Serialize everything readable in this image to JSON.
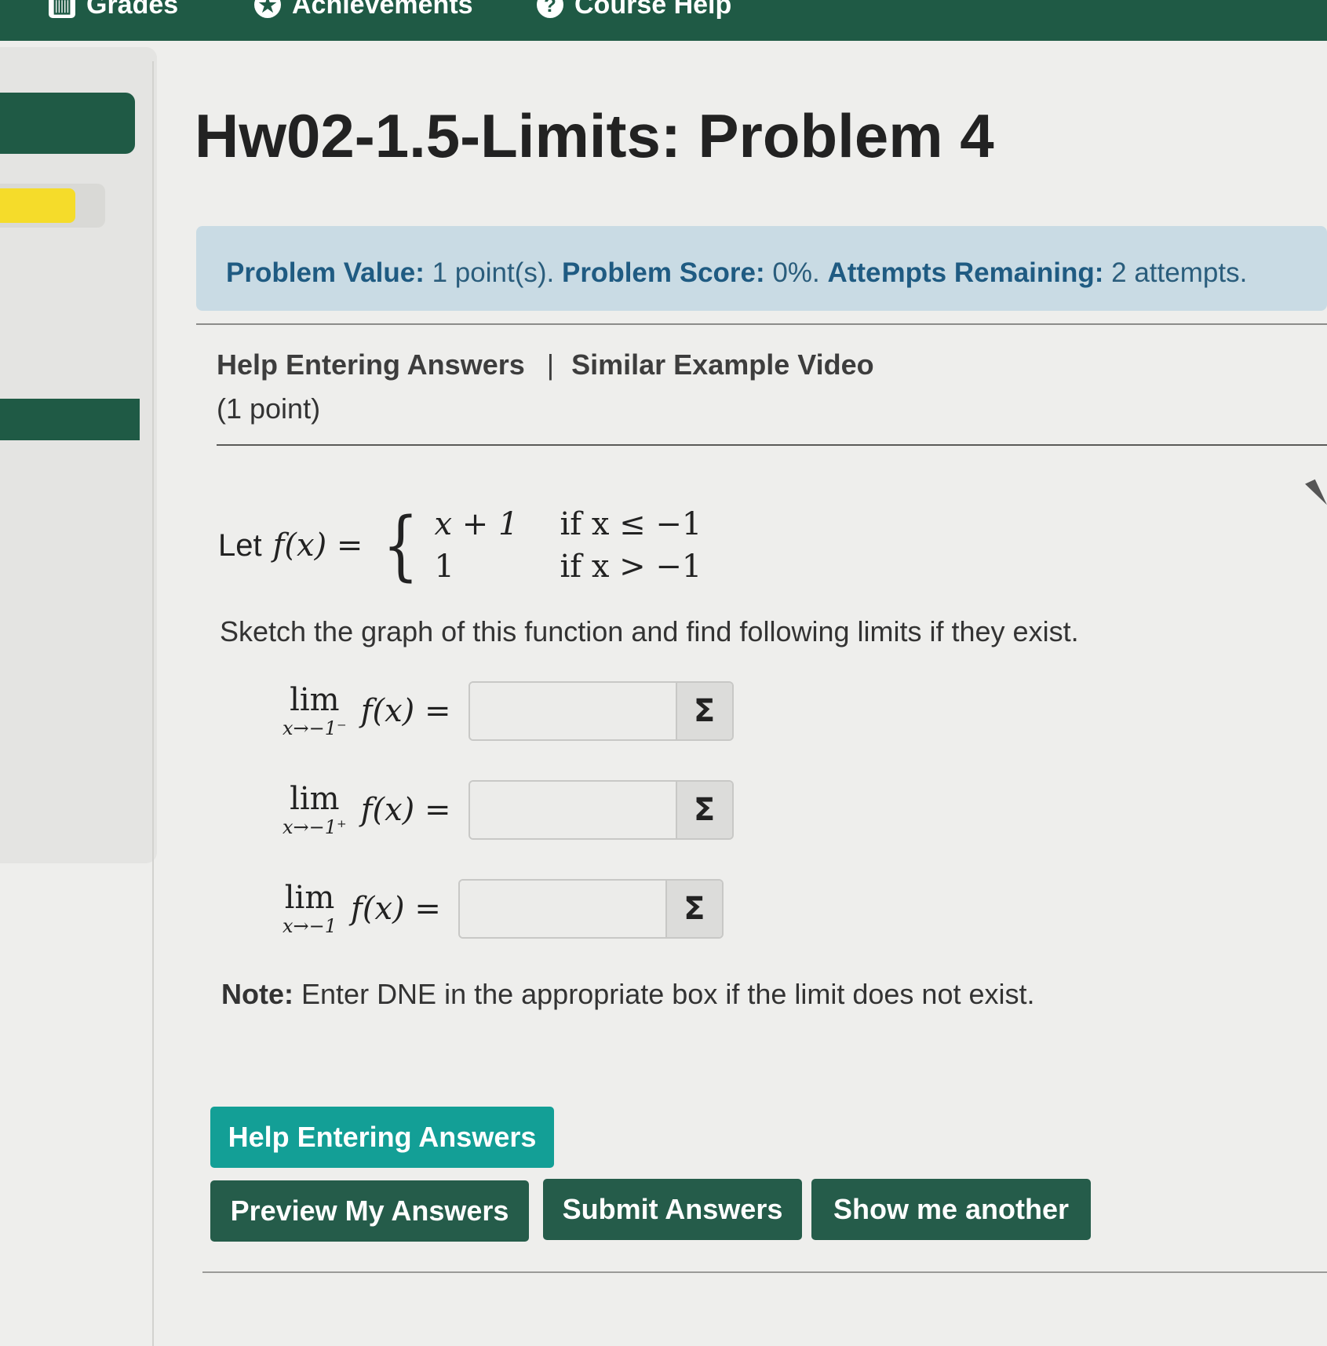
{
  "topnav": {
    "grades_label": "Grades",
    "achievements_label": "Achievements",
    "course_help_label": "Course Help"
  },
  "page_title": "Hw02-1.5-Limits: Problem 4",
  "score": {
    "value_label": "Problem Value:",
    "value_text": "1 point(s).",
    "score_label": "Problem Score:",
    "score_text": "0%.",
    "attempts_label": "Attempts Remaining:",
    "attempts_text": "2 attempts."
  },
  "help_links": {
    "help_entering": "Help Entering Answers",
    "separator": "|",
    "similar_video": "Similar Example Video"
  },
  "point_text": "(1 point)",
  "function_def": {
    "prefix": "Let",
    "lhs": "f(x) =",
    "cases": [
      {
        "expr": "x + 1",
        "cond": "if x ≤ −1"
      },
      {
        "expr": "1",
        "cond": "if x > −1"
      }
    ]
  },
  "instruction": "Sketch the graph of this function and find following limits if they exist.",
  "limits": [
    {
      "lim": "lim",
      "sub": "x→−1⁻",
      "expr": "f(x) =",
      "value": "",
      "button": "Σ"
    },
    {
      "lim": "lim",
      "sub": "x→−1⁺",
      "expr": "f(x) =",
      "value": "",
      "button": "Σ"
    },
    {
      "lim": "lim",
      "sub": "x→−1",
      "expr": "f(x) =",
      "value": "",
      "button": "Σ"
    }
  ],
  "note": {
    "label": "Note:",
    "text": "Enter DNE in the appropriate box if the limit does not exist."
  },
  "buttons": {
    "help_entering": "Help Entering Answers",
    "preview": "Preview My Answers",
    "submit": "Submit Answers",
    "show_another": "Show me another"
  },
  "colors": {
    "brand_green": "#1f5a45",
    "teal_button": "#139f96",
    "info_box": "#c9dbe4",
    "info_text": "#1f5b82",
    "progress_yellow": "#f5dc2a"
  }
}
